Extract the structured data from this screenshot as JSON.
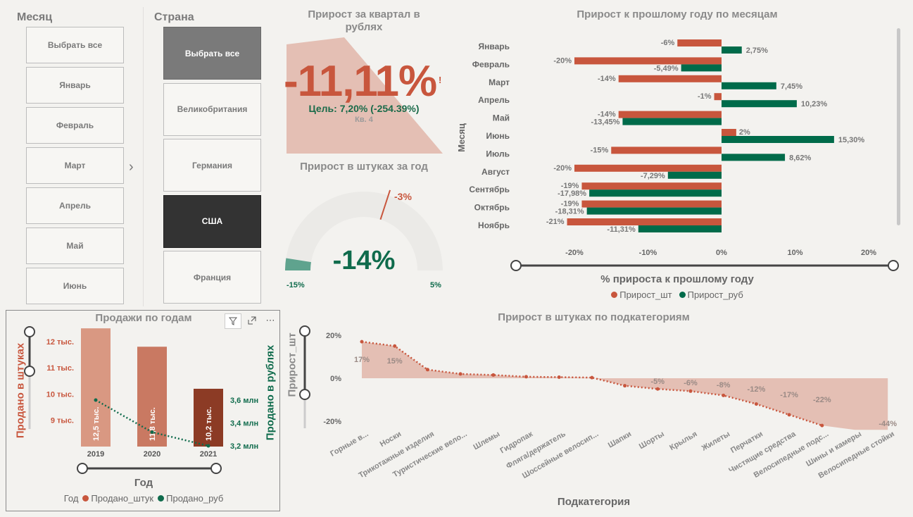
{
  "slicer_month": {
    "title": "Месяц",
    "items": [
      "Выбрать все",
      "Январь",
      "Февраль",
      "Март",
      "Апрель",
      "Май",
      "Июнь"
    ]
  },
  "slicer_country": {
    "title": "Страна",
    "items": [
      "Выбрать все",
      "Великобритания",
      "Германия",
      "США",
      "Франция"
    ]
  },
  "kpi_quarter": {
    "title": "Прирост за квартал в рублях",
    "value": "-11,11%",
    "alert": "!",
    "goal": "Цель: 7,20% (-254.39%)",
    "period": "Кв. 4"
  },
  "gauge_year": {
    "title": "Прирост в штуках за год",
    "value": "-14%",
    "min": "-15%",
    "max": "5%",
    "target": "-3%",
    "value_num": -14,
    "min_num": -15,
    "max_num": 5,
    "target_num": -3
  },
  "bar_month": {
    "title": "Прирост к прошлому году по месяцам",
    "ylabel": "Месяц",
    "xlabel": "% прироста к прошлому году",
    "x_ticks": [
      "-20%",
      "-10%",
      "0%",
      "10%",
      "20%"
    ],
    "legend": [
      "Прирост_шт",
      "Прирост_руб"
    ],
    "colors": {
      "units": "#c8563d",
      "rub": "#006b4a"
    }
  },
  "sales_year": {
    "title": "Продажи по годам",
    "ylabel_left": "Продано в штуках",
    "ylabel_right": "Продано в рублях",
    "xlabel": "Год",
    "left_ticks": [
      "12 тыс.",
      "11 тыс.",
      "10 тыс.",
      "9 тыс."
    ],
    "right_ticks": [
      "3,6 млн",
      "3,4 млн",
      "3,2 млн"
    ],
    "legend_title": "Год",
    "legend": [
      "Продано_штук",
      "Продано_руб"
    ],
    "icons": [
      "filter-icon",
      "focus-mode-icon",
      "more-options-icon"
    ]
  },
  "subcat": {
    "title": "Прирост в штуках по подкатегориям",
    "ylabel": "Прирост_шт",
    "xlabel": "Подкатегория",
    "y_ticks": [
      "20%",
      "0%",
      "-20%"
    ]
  },
  "chart_data": [
    {
      "type": "bar",
      "title": "Прирост к прошлому году по месяцам",
      "xlabel": "% прироста к прошлому году",
      "ylabel": "Месяц",
      "categories": [
        "Январь",
        "Февраль",
        "Март",
        "Апрель",
        "Май",
        "Июнь",
        "Июль",
        "Август",
        "Сентябрь",
        "Октябрь",
        "Ноябрь"
      ],
      "series": [
        {
          "name": "Прирост_шт",
          "values": [
            -6,
            -20,
            -14,
            -1,
            -14,
            2,
            -15,
            -20,
            -19,
            -19,
            -21
          ],
          "labels": [
            "-6%",
            "-20%",
            "-14%",
            "-1%",
            "-14%",
            "2%",
            "-15%",
            "-20%",
            "-19%",
            "-19%",
            "-21%"
          ]
        },
        {
          "name": "Прирост_руб",
          "values": [
            2.75,
            -5.49,
            7.45,
            10.23,
            -13.45,
            15.3,
            8.62,
            -7.29,
            -17.98,
            -18.31,
            -11.31
          ],
          "labels": [
            "2,75%",
            "-5,49%",
            "7,45%",
            "10,23%",
            "-13,45%",
            "15,30%",
            "8,62%",
            "-7,29%",
            "-17,98%",
            "-18,31%",
            "-11,31%"
          ]
        }
      ],
      "xlim": [
        -20,
        20
      ],
      "legend": "bottom"
    },
    {
      "type": "bar",
      "title": "Продажи по годам",
      "xlabel": "Год",
      "categories": [
        "2019",
        "2020",
        "2021"
      ],
      "series": [
        {
          "name": "Продано_штук",
          "values": [
            12.5,
            11.8,
            10.2
          ],
          "labels": [
            "12,5 тыс.",
            "11,8 тыс.",
            "10,2 тыс."
          ]
        },
        {
          "name": "Продано_руб",
          "values": [
            3.6,
            3.32,
            3.2
          ]
        }
      ],
      "ylim_left": [
        8,
        12.5
      ],
      "ylim_right": [
        3.1,
        3.75
      ]
    },
    {
      "type": "area",
      "title": "Прирост в штуках по подкатегориям",
      "xlabel": "Подкатегория",
      "ylabel": "Прирост_шт",
      "categories": [
        "Горные в...",
        "Носки",
        "Трикотажные изделия",
        "Туристические вело...",
        "Шлемы",
        "Гидропак",
        "Фляга/держатель",
        "Шоссейные велосип...",
        "Шапки",
        "Шорты",
        "Крылья",
        "Жилеты",
        "Перчатки",
        "Чистящие средства",
        "Велосипедные подс...",
        "Шины и камеры",
        "Велосипедные стойки"
      ],
      "values": [
        17,
        15,
        4,
        2,
        1.5,
        0.7,
        0.5,
        0.3,
        -3.5,
        -5,
        -6,
        -8,
        -12,
        -17,
        -22,
        -44,
        -44
      ],
      "labels": [
        "17%",
        "15%",
        "",
        "",
        "",
        "",
        "",
        "",
        "",
        "-5%",
        "-6%",
        "-8%",
        "-12%",
        "-17%",
        "-22%",
        "",
        "-44%"
      ],
      "ylim": [
        -24,
        20
      ]
    }
  ]
}
